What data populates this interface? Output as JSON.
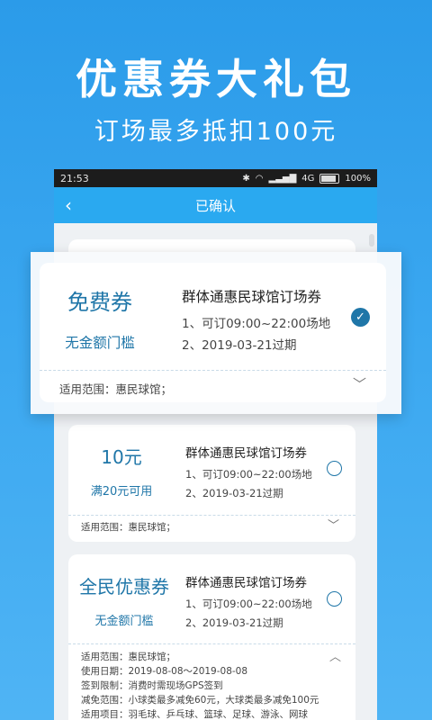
{
  "hero": {
    "title": "优惠券大礼包",
    "subtitle": "订场最多抵扣100元"
  },
  "statusbar": {
    "time": "21:53",
    "network": "4G",
    "battery": "100%"
  },
  "navbar": {
    "title": "已确认"
  },
  "coupons": [
    {
      "name": "免费券",
      "condition": "无金额门槛",
      "title": "群体通惠民球馆订场券",
      "line1": "1、可订09:00~22:00场地",
      "line2": "2、2019-03-21过期",
      "scope": "适用范围：惠民球馆；",
      "selected": true
    },
    {
      "name": "10元",
      "condition": "满20元可用",
      "title": "群体通惠民球馆订场券",
      "line1": "1、可订09:00~22:00场地",
      "line2": "2、2019-03-21过期",
      "scope": "适用范围：惠民球馆；",
      "selected": false
    },
    {
      "name": "全民优惠券",
      "condition": "无金额门槛",
      "title": "群体通惠民球馆订场券",
      "line1": "1、可订09:00~22:00场地",
      "line2": "2、2019-03-21过期",
      "selected": false,
      "details": [
        "适用范围：惠民球馆；",
        "使用日期：2019-08-08～2019-08-08",
        "签到限制：消费时需现场GPS签到",
        "减免范围：小球类最多减免60元，大球类最多减免100元",
        "适用项目：羽毛球、乒乓球、篮球、足球、游泳、网球"
      ]
    }
  ],
  "icons": {
    "back": "back-arrow-icon",
    "check": "check-circle-icon",
    "radio": "radio-empty-icon",
    "chevron_down": "chevron-down-icon",
    "chevron_up": "chevron-up-icon"
  },
  "colors": {
    "background": "#2b9be9",
    "navbar": "#2aa9f0",
    "accent": "#1f76a8"
  }
}
